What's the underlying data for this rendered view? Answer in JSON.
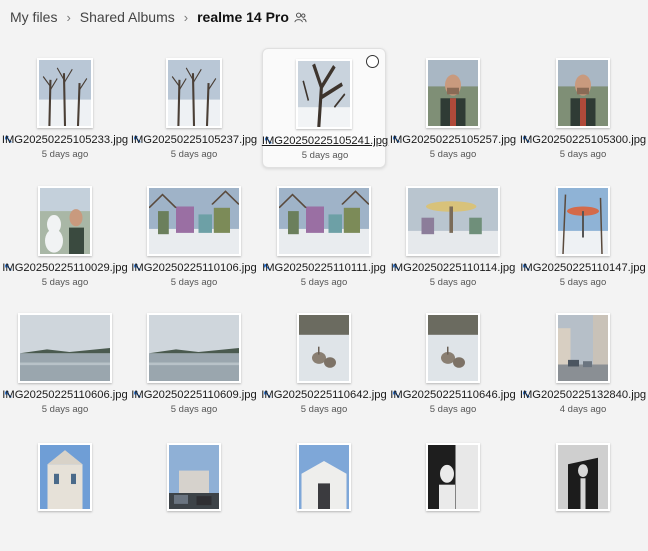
{
  "breadcrumb": {
    "items": [
      "My files",
      "Shared Albums"
    ],
    "current": "realme 14 Pro",
    "shared_icon": "people-icon"
  },
  "files": [
    {
      "name": "IMG20250225105233.jpg",
      "date": "5 days ago",
      "scene": "snow-trees"
    },
    {
      "name": "IMG20250225105237.jpg",
      "date": "5 days ago",
      "scene": "snow-trees"
    },
    {
      "name": "IMG20250225105241.jpg",
      "date": "5 days ago",
      "scene": "snow-tree-closeup",
      "selected": true
    },
    {
      "name": "IMG20250225105257.jpg",
      "date": "5 days ago",
      "scene": "selfie"
    },
    {
      "name": "IMG20250225105300.jpg",
      "date": "5 days ago",
      "scene": "selfie"
    },
    {
      "name": "IMG20250225110029.jpg",
      "date": "5 days ago",
      "scene": "selfie-snowman"
    },
    {
      "name": "IMG20250225110106.jpg",
      "date": "5 days ago",
      "scene": "playground"
    },
    {
      "name": "IMG20250225110111.jpg",
      "date": "5 days ago",
      "scene": "playground"
    },
    {
      "name": "IMG20250225110114.jpg",
      "date": "5 days ago",
      "scene": "carousel"
    },
    {
      "name": "IMG20250225110147.jpg",
      "date": "5 days ago",
      "scene": "carousel-portrait"
    },
    {
      "name": "IMG20250225110606.jpg",
      "date": "5 days ago",
      "scene": "frozen-lake"
    },
    {
      "name": "IMG20250225110609.jpg",
      "date": "5 days ago",
      "scene": "frozen-lake"
    },
    {
      "name": "IMG20250225110642.jpg",
      "date": "5 days ago",
      "scene": "geese"
    },
    {
      "name": "IMG20250225110646.jpg",
      "date": "5 days ago",
      "scene": "geese"
    },
    {
      "name": "IMG20250225132840.jpg",
      "date": "4 days ago",
      "scene": "street"
    },
    {
      "name": "",
      "date": "",
      "scene": "building"
    },
    {
      "name": "",
      "date": "",
      "scene": "street-cars"
    },
    {
      "name": "",
      "date": "",
      "scene": "building-white"
    },
    {
      "name": "",
      "date": "",
      "scene": "mural"
    },
    {
      "name": "",
      "date": "",
      "scene": "mural-tall"
    }
  ]
}
